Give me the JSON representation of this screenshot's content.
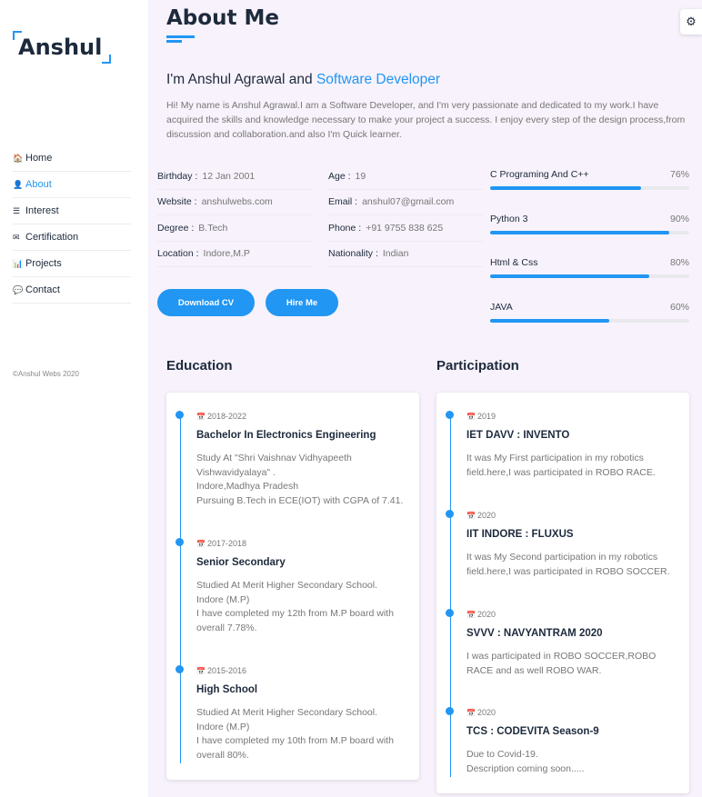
{
  "brand": {
    "name": "Anshul"
  },
  "nav": [
    {
      "icon": "home-icon",
      "glyph": "🏠",
      "label": "Home"
    },
    {
      "icon": "user-icon",
      "glyph": "👤",
      "label": "About"
    },
    {
      "icon": "list-icon",
      "glyph": "☰",
      "label": "Interest"
    },
    {
      "icon": "envelope-icon",
      "glyph": "✉",
      "label": "Certification"
    },
    {
      "icon": "chart-icon",
      "glyph": "📊",
      "label": "Projects"
    },
    {
      "icon": "comments-icon",
      "glyph": "💬",
      "label": "Contact"
    }
  ],
  "active_nav": "About",
  "copyright": "©Anshul Webs 2020",
  "page": {
    "title": "About Me"
  },
  "settings_icon": "gear-icon",
  "intro": {
    "prefix": "I'm Anshul Agrawal and ",
    "role": "Software Developer"
  },
  "bio": "Hi! My name is Anshul Agrawal.I am a Software Developer, and I'm very passionate and dedicated to my work.I have acquired the skills and knowledge necessary to make your project a success. I enjoy every step of the design process,from discussion and collaboration.and also I'm Quick learner.",
  "info": {
    "col1": [
      {
        "label": "Birthday :",
        "value": "12 Jan 2001"
      },
      {
        "label": "Website :",
        "value": "anshulwebs.com"
      },
      {
        "label": "Degree :",
        "value": "B.Tech"
      },
      {
        "label": "Location :",
        "value": "Indore,M.P"
      }
    ],
    "col2": [
      {
        "label": "Age :",
        "value": "19"
      },
      {
        "label": "Email :",
        "value": "anshul07@gmail.com"
      },
      {
        "label": "Phone :",
        "value": "+91 9755 838 625"
      },
      {
        "label": "Nationality :",
        "value": "Indian"
      }
    ]
  },
  "skills": [
    {
      "name": "C Programing And C++",
      "percent": 76,
      "label": "76%"
    },
    {
      "name": "Python 3",
      "percent": 90,
      "label": "90%"
    },
    {
      "name": "Html & Css",
      "percent": 80,
      "label": "80%"
    },
    {
      "name": "JAVA",
      "percent": 60,
      "label": "60%"
    }
  ],
  "buttons": {
    "download_cv": "Download CV",
    "hire_me": "Hire Me"
  },
  "colors": {
    "accent": "#2196f3",
    "heading": "#1d2a3c",
    "muted": "#777777"
  },
  "education": {
    "title": "Education",
    "items": [
      {
        "date": "2018-2022",
        "title": "Bachelor In Electronics Engineering",
        "desc": [
          "Study At \"Shri Vaishnav Vidhyapeeth Vishwavidyalaya\" .",
          "Indore,Madhya Pradesh",
          "Pursuing B.Tech in ECE(IOT) with CGPA of 7.41."
        ]
      },
      {
        "date": "2017-2018",
        "title": "Senior Secondary",
        "desc": [
          "Studied At Merit Higher Secondary School.",
          "Indore (M.P)",
          "I have completed my 12th from M.P board with overall 7.78%."
        ]
      },
      {
        "date": "2015-2016",
        "title": "High School",
        "desc": [
          "Studied At Merit Higher Secondary School.",
          "Indore (M.P)",
          "I have completed my 10th from M.P board with overall 80%."
        ]
      }
    ]
  },
  "participation": {
    "title": "Participation",
    "items": [
      {
        "date": "2019",
        "title": "IET DAVV : INVENTO",
        "desc": [
          "It was My First participation in my robotics field.here,I was participated in ROBO RACE."
        ]
      },
      {
        "date": "2020",
        "title": "IIT INDORE : FLUXUS",
        "desc": [
          "It was My Second participation in my robotics field.here,I was participated in ROBO SOCCER."
        ]
      },
      {
        "date": "2020",
        "title": "SVVV : NAVYANTRAM 2020",
        "desc": [
          "I was participated in ROBO SOCCER,ROBO RACE and as well ROBO WAR."
        ]
      },
      {
        "date": "2020",
        "title": "TCS : CODEVITA Season-9",
        "desc": [
          "Due to Covid-19.",
          "Description coming soon....."
        ]
      }
    ]
  }
}
